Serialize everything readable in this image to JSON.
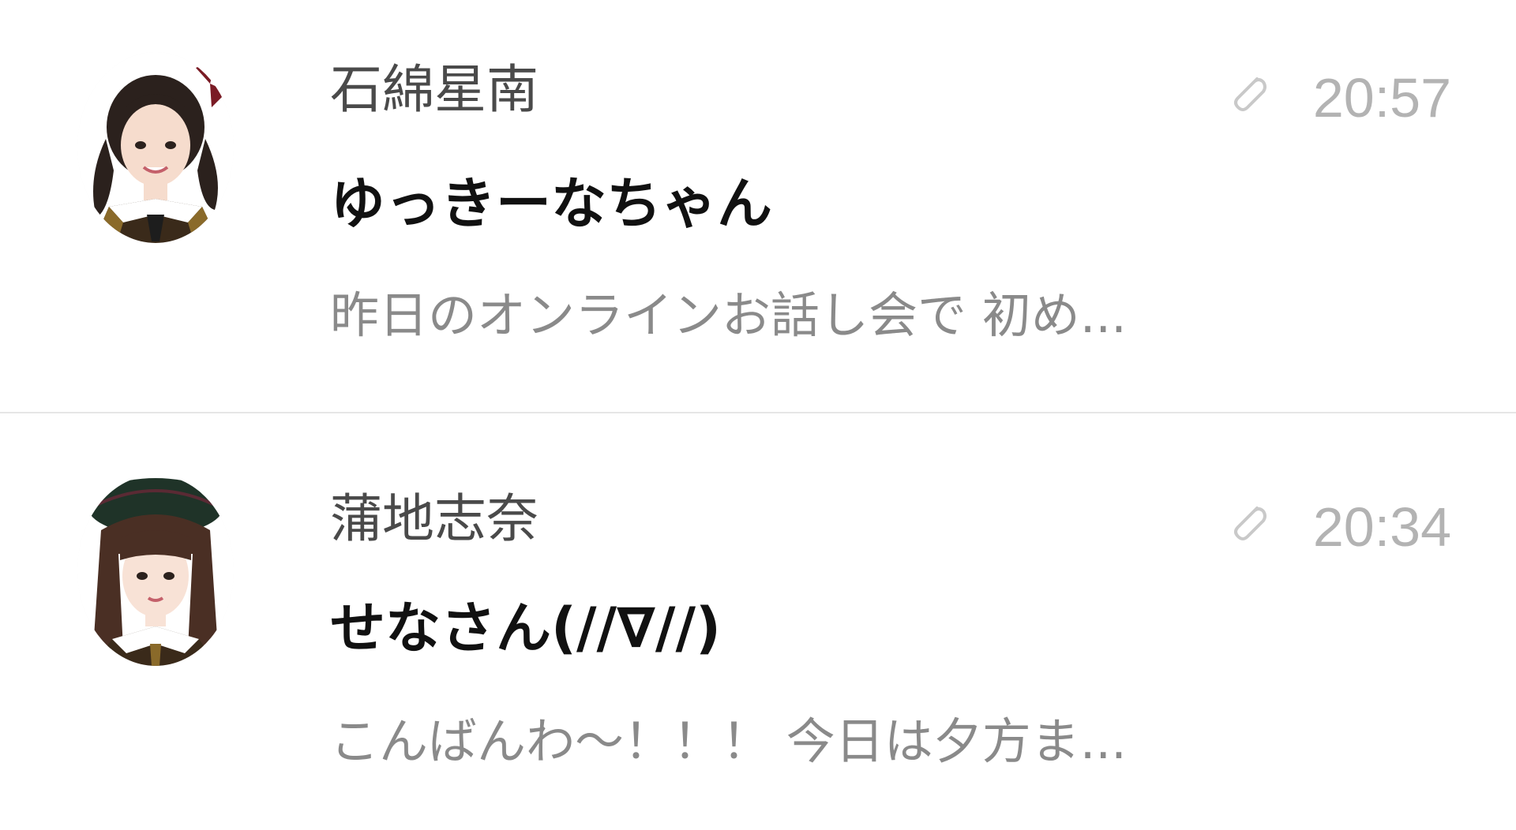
{
  "messages": [
    {
      "sender": "石綿星南",
      "subject": "ゆっきーなちゃん",
      "preview": "昨日のオンラインお話し会で 初め...",
      "time": "20:57",
      "has_attachment": true,
      "attachment_icon": "paperclip-icon",
      "avatar_icon": "avatar-photo"
    },
    {
      "sender": "蒲地志奈",
      "subject": "せなさん(//∇//)",
      "preview": "こんばんわ〜！！！ 今日は夕方ま...",
      "time": "20:34",
      "has_attachment": true,
      "attachment_icon": "paperclip-icon",
      "avatar_icon": "avatar-photo"
    }
  ],
  "colors": {
    "sender": "#4a4a4a",
    "subject": "#111111",
    "preview": "#8a8a8a",
    "time": "#b3b3b3",
    "divider": "#e6e6e6"
  }
}
